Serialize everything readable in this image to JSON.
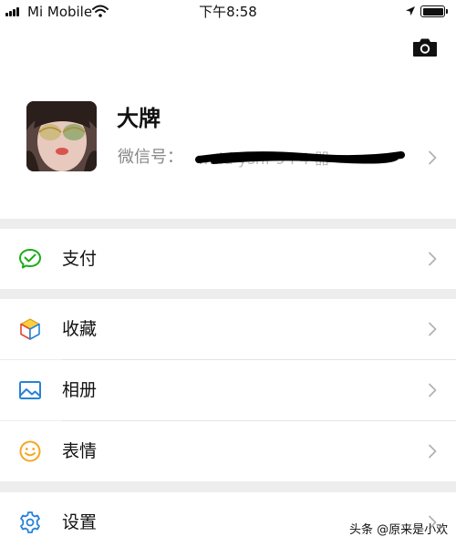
{
  "status_bar": {
    "carrier": "Mi Mobile",
    "time": "下午8:58"
  },
  "profile": {
    "name": "大牌",
    "wechat_id_label": "微信号："
  },
  "menu": [
    {
      "label": "支付",
      "icon": "wechat-pay-icon",
      "color": "#1aad19"
    },
    {
      "label": "收藏",
      "icon": "favorites-cube-icon",
      "color": "#f5a623"
    },
    {
      "label": "相册",
      "icon": "album-icon",
      "color": "#2782d7"
    },
    {
      "label": "表情",
      "icon": "sticker-smiley-icon",
      "color": "#f5a623"
    },
    {
      "label": "设置",
      "icon": "settings-gear-icon",
      "color": "#2782d7"
    }
  ],
  "watermark": "头条 @原来是小欢"
}
